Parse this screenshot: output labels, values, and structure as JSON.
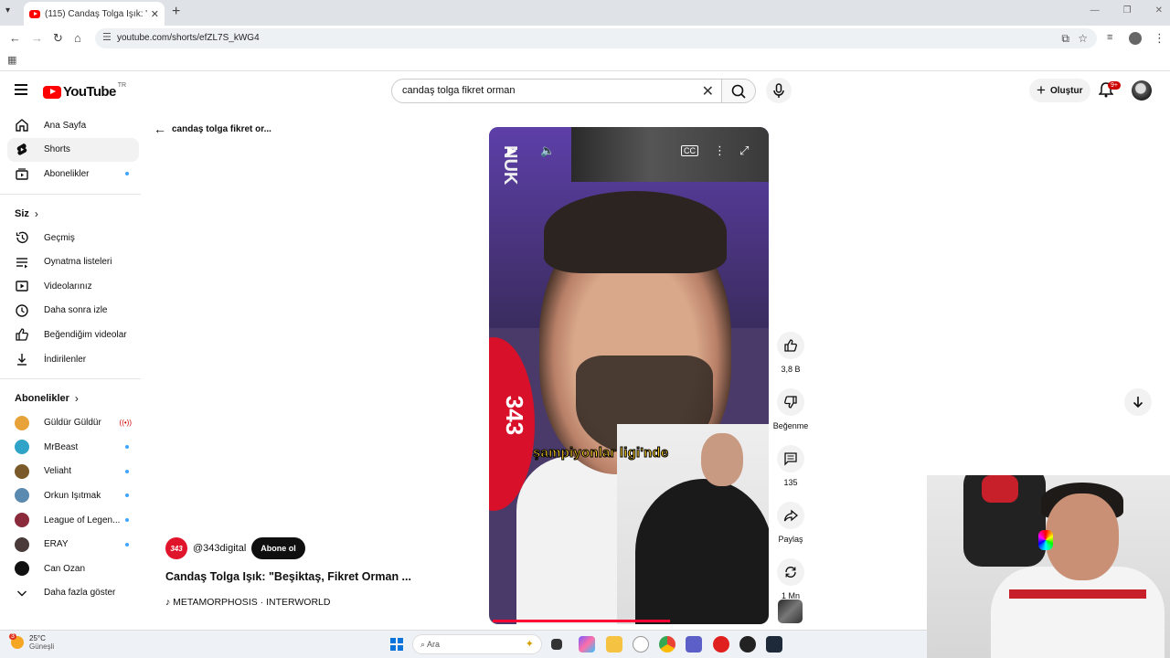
{
  "browser": {
    "tab_title": "(115) Candaş Tolga Işık: \"Beşiktaş",
    "url": "youtube.com/shorts/efZL7S_kWG4"
  },
  "yt": {
    "logo_text": "YouTube",
    "country": "TR",
    "search_value": "candaş tolga fikret orman",
    "create_label": "Oluştur",
    "notif_count": "9+"
  },
  "sidebar": {
    "main": [
      {
        "label": "Ana Sayfa",
        "icon": "home-icon"
      },
      {
        "label": "Shorts",
        "icon": "shorts-icon"
      },
      {
        "label": "Abonelikler",
        "icon": "subscriptions-icon"
      }
    ],
    "you_heading": "Siz",
    "you": [
      {
        "label": "Geçmiş",
        "icon": "history-icon"
      },
      {
        "label": "Oynatma listeleri",
        "icon": "playlists-icon"
      },
      {
        "label": "Videolarınız",
        "icon": "your-videos-icon"
      },
      {
        "label": "Daha sonra izle",
        "icon": "watch-later-icon"
      },
      {
        "label": "Beğendiğim videolar",
        "icon": "liked-videos-icon"
      },
      {
        "label": "İndirilenler",
        "icon": "downloads-icon"
      }
    ],
    "subs_heading": "Abonelikler",
    "subs": [
      {
        "label": "Güldür Güldür",
        "status": "live",
        "color": "#e8a23a"
      },
      {
        "label": "MrBeast",
        "status": "dot",
        "color": "#2fa4c8"
      },
      {
        "label": "Veliaht",
        "status": "dot",
        "color": "#7a5a2a"
      },
      {
        "label": "Orkun Işıtmak",
        "status": "dot",
        "color": "#5a8ab0"
      },
      {
        "label": "League of Legen...",
        "status": "dot",
        "color": "#8a2a3a"
      },
      {
        "label": "ERAY",
        "status": "dot",
        "color": "#4a3a3a"
      },
      {
        "label": "Can Ozan",
        "status": "",
        "color": "#111111"
      }
    ],
    "show_more": "Daha fazla göster"
  },
  "short": {
    "back_label": "candaş tolga fikret or...",
    "channel_logo": "343",
    "channel_handle": "@343digital",
    "subscribe_label": "Abone ol",
    "title": "Candaş Tolga Işık: \"Beşiktaş, Fikret Orman ...",
    "music": "METAMORPHOSIS · INTERWORLD",
    "caption": "şampiyonlar ligi'nde",
    "overlay_text": "NUK",
    "red_logo": "343",
    "progress": 0.65,
    "likes": "3,8 B",
    "dislike_label": "Beğenme",
    "comments": "135",
    "share_label": "Paylaş",
    "remix_label": "1 Mn"
  },
  "taskbar": {
    "temp": "25°C",
    "condition": "Güneşli",
    "weather_badge": "3",
    "search_placeholder": "Ara"
  },
  "colors": {
    "accent": "#ff0000",
    "live": "#cc0000",
    "dot": "#3ea6ff"
  }
}
